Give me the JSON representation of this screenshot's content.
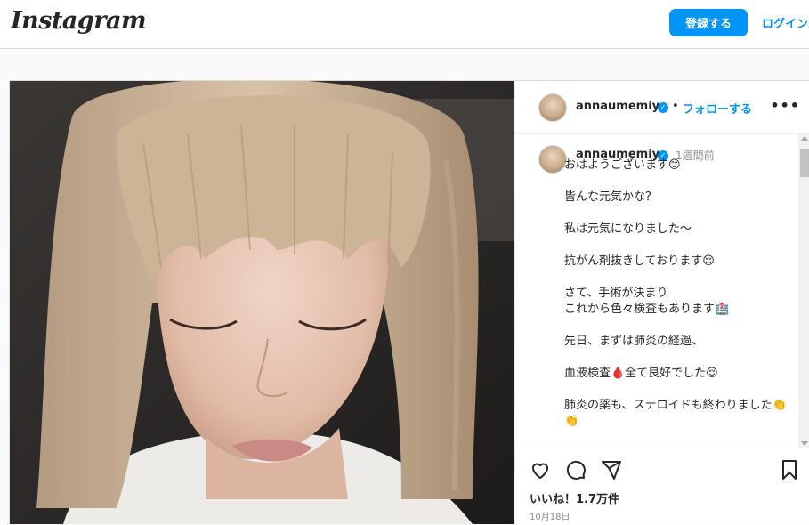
{
  "header": {
    "logo_text": "Instagram",
    "signup_label": "登録する",
    "login_label": "ログイン"
  },
  "post": {
    "username": "annaumemiya",
    "follow_label": "フォローする",
    "dot": "•",
    "more_label": "•••",
    "comment_username": "annaumemiya",
    "time_ago": "1週間前",
    "caption_paragraphs": [
      "おはようございます😊",
      "皆んな元気かな？",
      "私は元気になりました〜",
      "抗がん剤抜きしております😌",
      "さて、手術が決まり\nこれから色々検査もあります🏥",
      "先日、まずは肺炎の経過、",
      "血液検査🩸全て良好でした😌",
      "肺炎の薬も、ステロイドも終わりました👏👏"
    ],
    "likes": "いいね！1.7万件",
    "date": "10月18日"
  },
  "icons": {
    "verified": "verified-badge-icon",
    "like": "heart-icon",
    "comment": "comment-icon",
    "share": "share-icon",
    "save": "bookmark-icon",
    "more": "more-options-icon"
  },
  "colors": {
    "accent": "#0095f6",
    "text": "#262626",
    "muted": "#8e8e8e",
    "border": "#dbdbdb"
  }
}
